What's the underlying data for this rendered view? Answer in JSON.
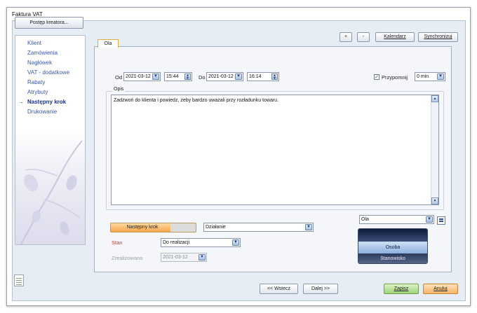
{
  "window": {
    "title": "Faktura VAT"
  },
  "wizard": {
    "progress_button": "Postęp kreatora...",
    "steps": [
      {
        "label": "Klient",
        "active": false
      },
      {
        "label": "Zamówienia",
        "active": false
      },
      {
        "label": "Nagłówek",
        "active": false
      },
      {
        "label": "VAT - dodatkowe",
        "active": false
      },
      {
        "label": "Rabaty",
        "active": false
      },
      {
        "label": "Atrybuty",
        "active": false
      },
      {
        "label": "Następny krok",
        "active": true
      },
      {
        "label": "Drukowanie",
        "active": false
      }
    ],
    "current_arrow": "→"
  },
  "toolbar": {
    "plus_label": "+",
    "minus_label": "-",
    "calendar_label": "Kalendarz",
    "sync_label": "Synchronizuj"
  },
  "tab": {
    "label": "Ola"
  },
  "schedule": {
    "from_label": "Od",
    "from_date": "2021-03-12",
    "from_time": "15:44",
    "to_label": "Do",
    "to_date": "2021-03-12",
    "to_time": "16:14",
    "remind_label": "Przypomnij",
    "remind_checked": true,
    "remind_value": "0 min"
  },
  "description": {
    "label": "Opis",
    "text": "Zadzwoń do klienta i powiedz, żeby bardzo uważali przy rozładunku towaru."
  },
  "next_step": {
    "progress_label": "Następny krok",
    "progress_fraction": 0.7,
    "action_value": "Działanie",
    "stan_label": "Stan",
    "stan_value": "Do realizacji",
    "zrealizowano_label": "Zrealizowano",
    "zrealizowano_value": "2021-03-12"
  },
  "assignee": {
    "value": "Ola",
    "option_person": "Osoba",
    "option_station": "Stanowisko"
  },
  "footer": {
    "back_label": "<< Wstecz",
    "next_label": "Dalej >>",
    "save_label": "Zapisz",
    "cancel_label": "Anuluj"
  },
  "colors": {
    "accent_orange": "#f5a64a",
    "link_blue": "#3a5aa8",
    "stan_red": "#c0392b",
    "save_green": "#9fd37a"
  }
}
